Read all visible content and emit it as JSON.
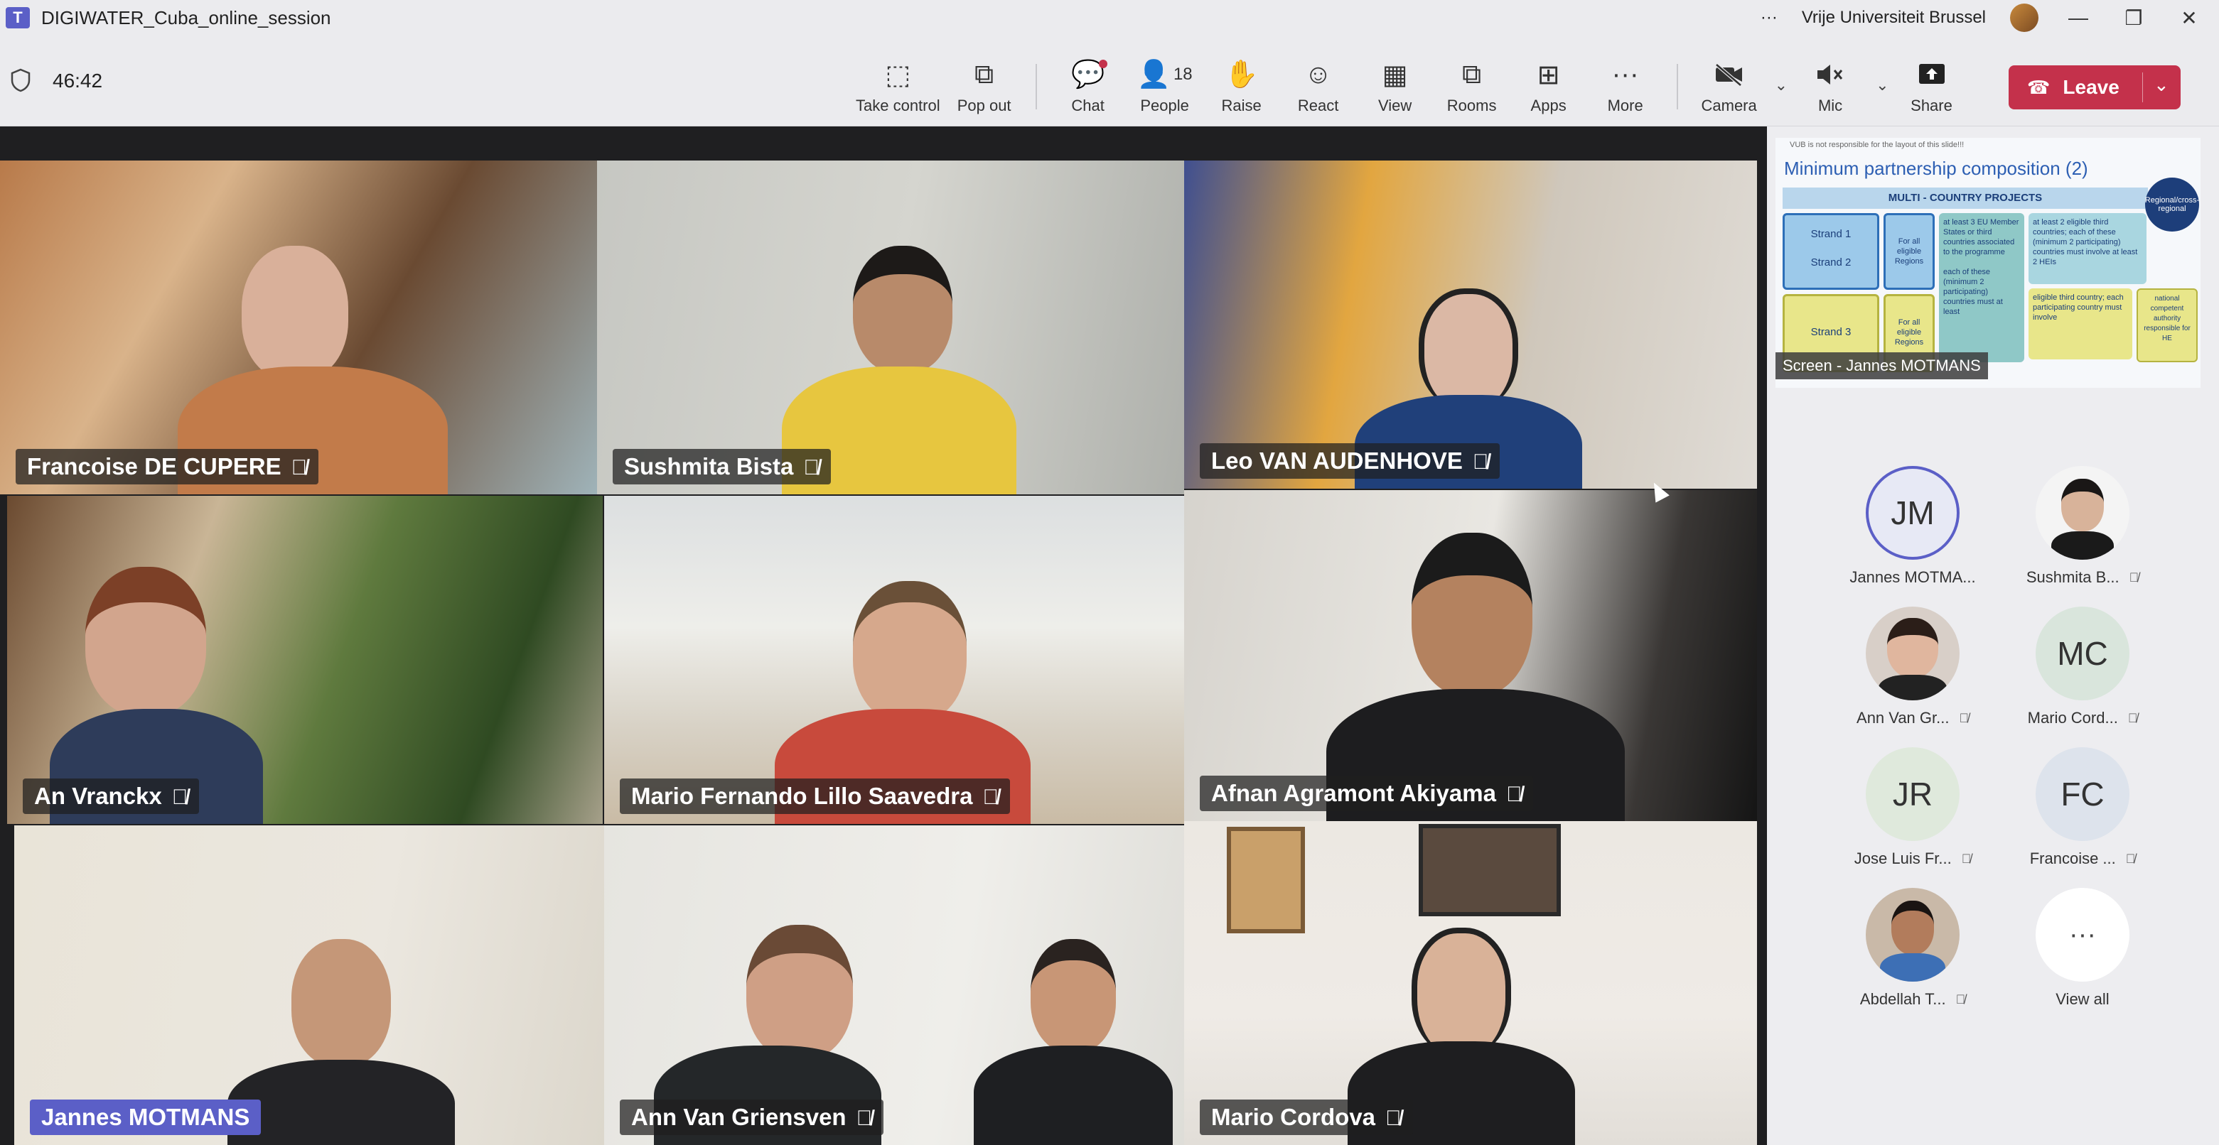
{
  "window": {
    "title": "DIGIWATER_Cuba_online_session",
    "org": "Vrije Universiteit Brussel",
    "more": "···"
  },
  "meeting": {
    "timer": "46:42"
  },
  "toolbar": {
    "items": [
      {
        "label": "Take control",
        "icon": "take-control-icon",
        "glyph": "⬚"
      },
      {
        "label": "Pop out",
        "icon": "pop-out-icon",
        "glyph": "⧉"
      },
      {
        "label": "Chat",
        "icon": "chat-icon",
        "glyph": "💬"
      },
      {
        "label": "People",
        "icon": "people-icon",
        "glyph": "👤",
        "count": "18"
      },
      {
        "label": "Raise",
        "icon": "raise-hand-icon",
        "glyph": "✋"
      },
      {
        "label": "React",
        "icon": "react-icon",
        "glyph": "☺"
      },
      {
        "label": "View",
        "icon": "view-icon",
        "glyph": "▦"
      },
      {
        "label": "Rooms",
        "icon": "rooms-icon",
        "glyph": "⧉"
      },
      {
        "label": "Apps",
        "icon": "apps-icon",
        "glyph": "⊞"
      },
      {
        "label": "More",
        "icon": "more-icon",
        "glyph": "···"
      },
      {
        "label": "Camera",
        "icon": "camera-off-icon",
        "glyph": "▶"
      },
      {
        "label": "Mic",
        "icon": "mic-off-icon",
        "glyph": "🔈"
      },
      {
        "label": "Share",
        "icon": "share-icon",
        "glyph": "⬆"
      }
    ],
    "leave_label": "Leave"
  },
  "tiles": [
    {
      "name": "Francoise DE CUPERE"
    },
    {
      "name": "Sushmita Bista"
    },
    {
      "name": "Leo VAN AUDENHOVE"
    },
    {
      "name": "An Vranckx"
    },
    {
      "name": "Mario Fernando Lillo Saavedra"
    },
    {
      "name": "Afnan Agramont Akiyama"
    },
    {
      "name": "Jannes MOTMANS"
    },
    {
      "name": "Ann Van Griensven"
    },
    {
      "name": "Mario Cordova"
    }
  ],
  "slide": {
    "note": "VUB is not responsible for the layout of this slide!!!",
    "title": "Minimum partnership composition (2)",
    "band": "MULTI - COUNTRY PROJECTS",
    "seal": "Regional/cross-regional",
    "strand1": "Strand 1",
    "strand2": "Strand 2",
    "strand3": "Strand 3",
    "eligible": "For all eligible Regions",
    "cell_a": "at least 3 EU Member States or third countries associated to the programme",
    "cell_a2": "each of these (minimum 2 participating) countries must at least",
    "cell_b": "at least 2 eligible third countries; each of these (minimum 2 participating) countries must involve at least 2 HEIs",
    "cell_c": "eligible third country; each participating country must involve",
    "cell_d": "national competent authority responsible for HE",
    "screen_label": "Screen - Jannes MOTMANS"
  },
  "roster": [
    {
      "name": "Jannes MOTMA...",
      "initials": "JM",
      "muted": false,
      "color": "#e7e9f5"
    },
    {
      "name": "Sushmita B...",
      "initials": "",
      "muted": true,
      "color": "#f4f4f4"
    },
    {
      "name": "Ann Van Gr...",
      "initials": "",
      "muted": true,
      "color": "#d8cfc8"
    },
    {
      "name": "Mario Cord...",
      "initials": "MC",
      "muted": true,
      "color": "#d9e5dc"
    },
    {
      "name": "Jose Luis Fr...",
      "initials": "JR",
      "muted": true,
      "color": "#dfe9dc"
    },
    {
      "name": "Francoise ...",
      "initials": "FC",
      "muted": true,
      "color": "#dde3ec"
    },
    {
      "name": "Abdellah T...",
      "initials": "",
      "muted": true,
      "color": "#c9b9a8"
    },
    {
      "name": "View all",
      "initials": "",
      "muted": false,
      "color": "#ffffff"
    }
  ]
}
